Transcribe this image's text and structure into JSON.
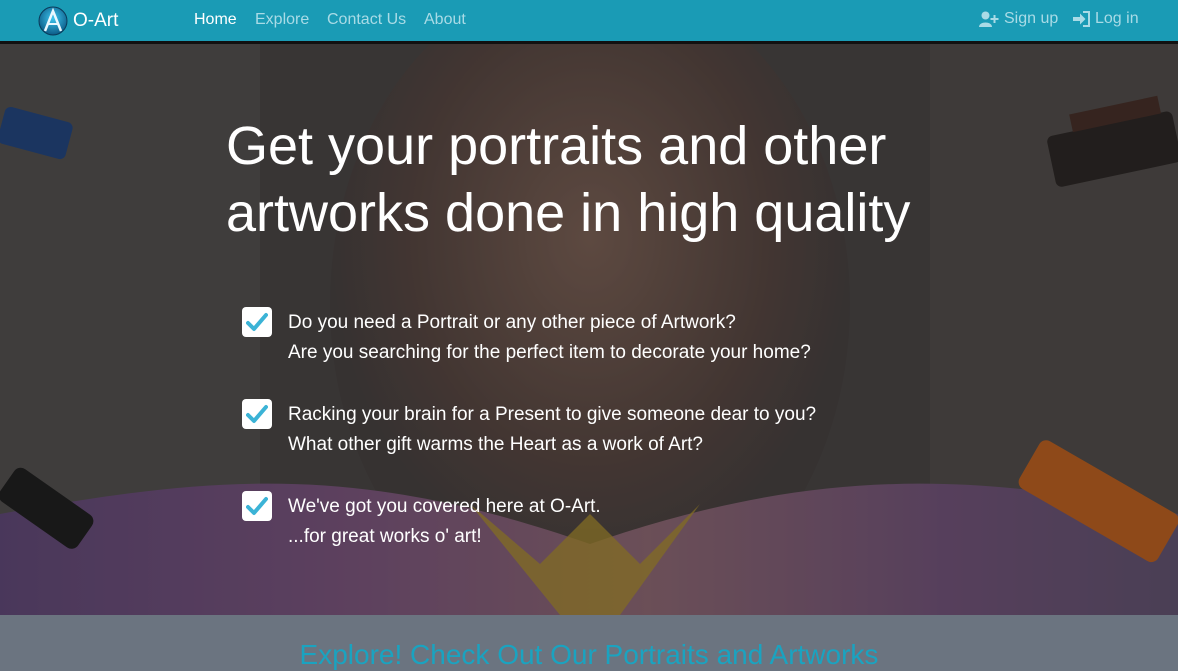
{
  "nav": {
    "brand": "O-Art",
    "links": [
      "Home",
      "Explore",
      "Contact Us",
      "About"
    ],
    "signup": "Sign up",
    "login": "Log in",
    "icons": {
      "brand": "o-art-logo",
      "signup": "user-plus-icon",
      "login": "sign-in-icon"
    }
  },
  "hero": {
    "title": "Get your portraits and other artworks done in high quality",
    "items": [
      {
        "line1": "Do you need a Portrait or any other piece of Artwork?",
        "line2": "Are you searching for the perfect item to decorate your home?"
      },
      {
        "line1": "Racking your brain for a Present to give someone dear to you?",
        "line2": "What other gift warms the Heart as a work of Art?"
      },
      {
        "line1": "We've got you covered here at O-Art.",
        "line2": "...for great works o' art!"
      }
    ]
  },
  "explore": {
    "heading": "Explore! Check Out Our Portraits and Artworks"
  },
  "colors": {
    "navbar": "#1a9bb5",
    "accent": "#1aa3c0",
    "check": "#3bb3d6",
    "band": "#6b7480"
  }
}
